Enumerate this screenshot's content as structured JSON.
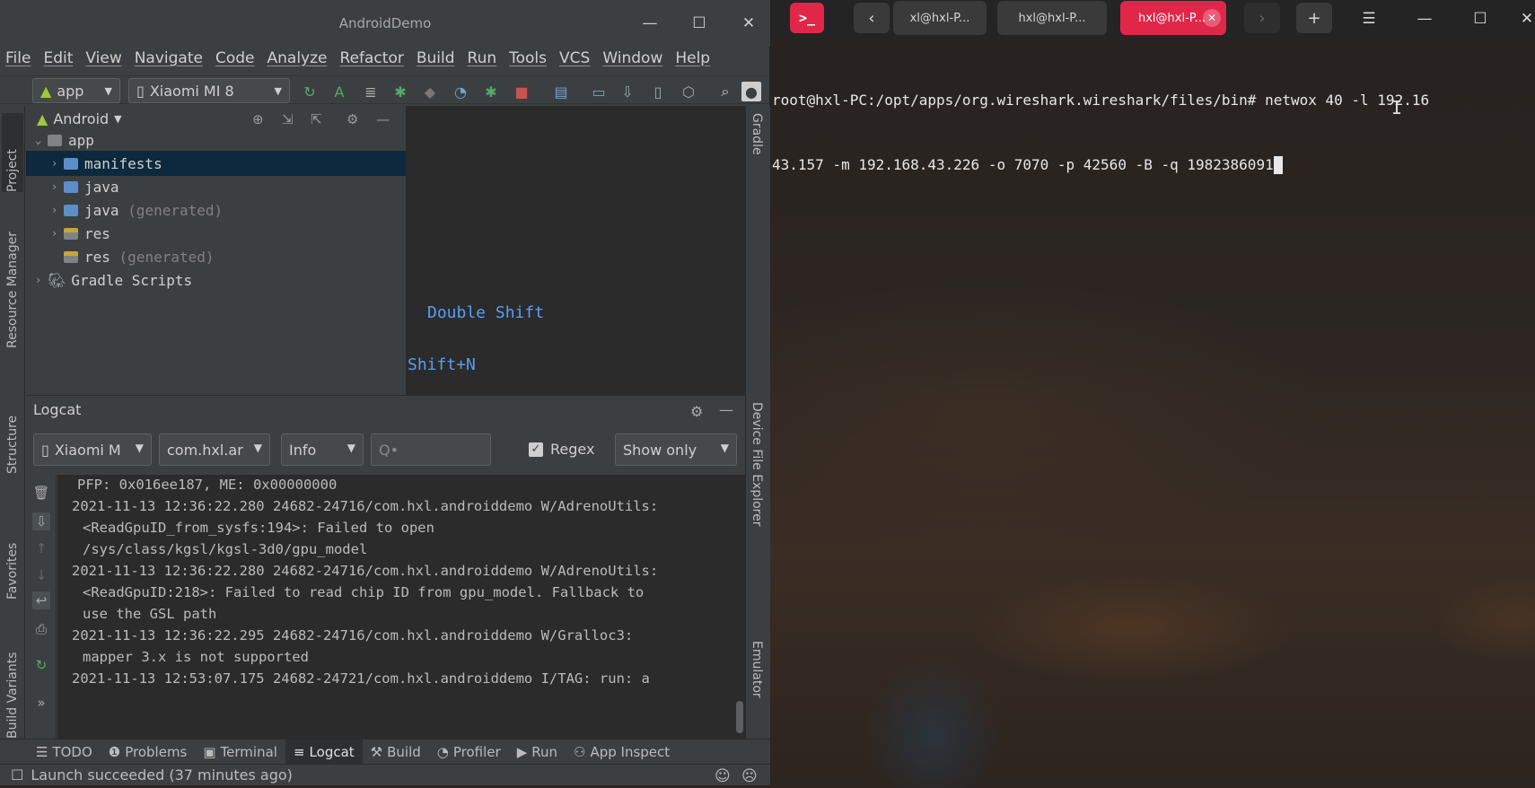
{
  "terminal": {
    "app_icon": ">_",
    "tabs": [
      "xl@hxl-P...",
      "hxl@hxl-P...",
      "hxl@hxl-P..."
    ],
    "lines": [
      "root@hxl-PC:/opt/apps/org.wireshark.wireshark/files/bin# netwox 40 -l 192.16",
      "43.157 -m 192.168.43.226 -o 7070 -p 42560 -B -q 1982386091"
    ],
    "accent_color": "#e0274a"
  },
  "studio": {
    "window_title": "AndroidDemo",
    "menu": [
      "File",
      "Edit",
      "View",
      "Navigate",
      "Code",
      "Analyze",
      "Refactor",
      "Build",
      "Run",
      "Tools",
      "VCS",
      "Window",
      "Help"
    ],
    "toolbar": {
      "config": "app",
      "device": "Xiaomi MI 8"
    },
    "left_tabs": [
      "Project",
      "Resource Manager",
      "Structure",
      "Favorites",
      "Build Variants"
    ],
    "right_tabs": [
      "Gradle",
      "Device File Explorer",
      "Emulator"
    ],
    "project": {
      "view_name": "Android",
      "tree": [
        {
          "label": "app",
          "suffix": ""
        },
        {
          "label": "manifests",
          "suffix": ""
        },
        {
          "label": "java",
          "suffix": ""
        },
        {
          "label": "java",
          "suffix": "(generated)"
        },
        {
          "label": "res",
          "suffix": ""
        },
        {
          "label": "res",
          "suffix": "(generated)"
        },
        {
          "label": "Gradle Scripts",
          "suffix": ""
        }
      ]
    },
    "editor": {
      "hint_search": "Double Shift",
      "hint_goto": "Shift+N"
    },
    "logcat": {
      "title": "Logcat",
      "device_filter": "Xiaomi M",
      "package_filter": "com.hxl.ar",
      "level": "Info",
      "search_placeholder": "Q•",
      "regex_label": "Regex",
      "show_mode": "Show only",
      "lines": [
        "PFP: 0x016ee187, ME: 0x00000000",
        "2021-11-13 12:36:22.280 24682-24716/com.hxl.androiddemo W/AdrenoUtils:",
        "<ReadGpuID_from_sysfs:194>: Failed to open",
        "/sys/class/kgsl/kgsl-3d0/gpu_model",
        "2021-11-13 12:36:22.280 24682-24716/com.hxl.androiddemo W/AdrenoUtils:",
        "<ReadGpuID:218>: Failed to read chip ID from gpu_model. Fallback to",
        "use the GSL path",
        "2021-11-13 12:36:22.295 24682-24716/com.hxl.androiddemo W/Gralloc3:",
        "mapper 3.x is not supported",
        "2021-11-13 12:53:07.175 24682-24721/com.hxl.androiddemo I/TAG: run: a"
      ]
    },
    "bottom_tabs": [
      "TODO",
      "Problems",
      "Terminal",
      "Logcat",
      "Build",
      "Profiler",
      "Run",
      "App Inspect"
    ],
    "status": "Launch succeeded (37 minutes ago)"
  }
}
